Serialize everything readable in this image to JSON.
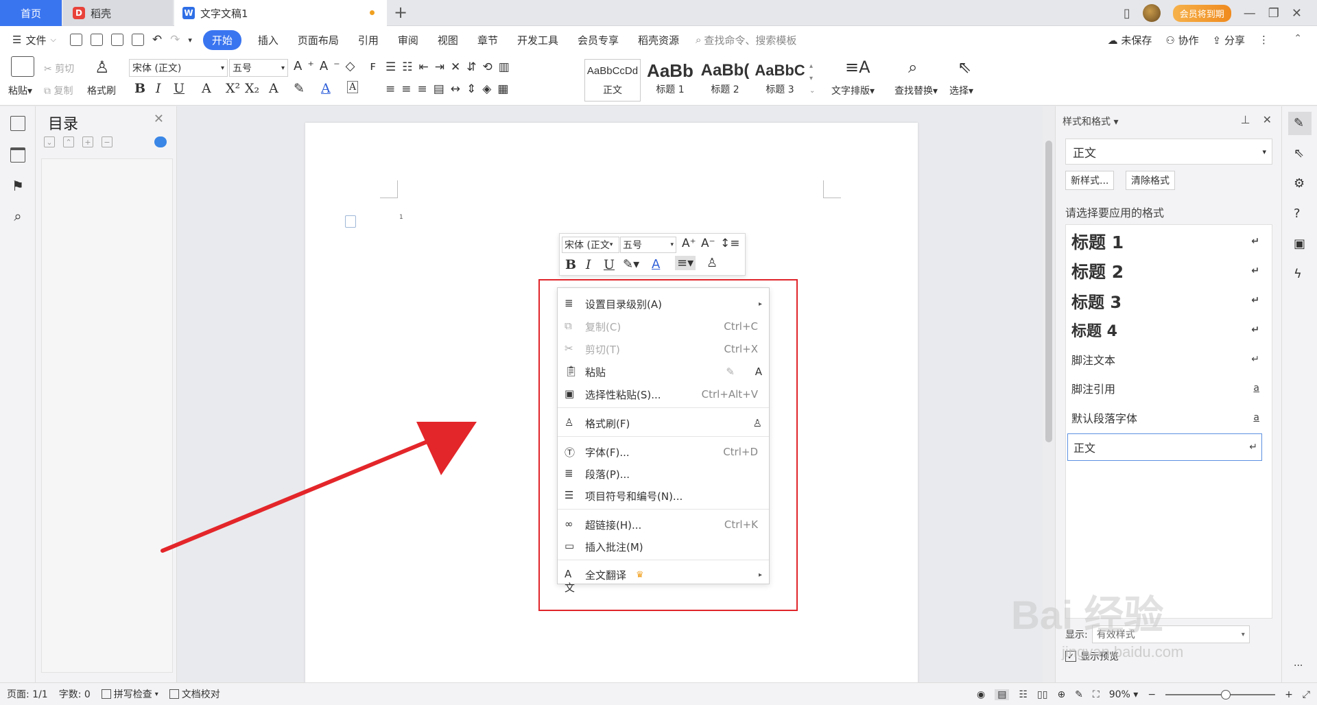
{
  "tabs": {
    "home": "首页",
    "daoke": "稻壳",
    "doc": "文字文稿1",
    "new_tab": "+",
    "vip": "会员将到期"
  },
  "menubar": {
    "file": "文件",
    "start": "开始",
    "items": [
      "插入",
      "页面布局",
      "引用",
      "审阅",
      "视图",
      "章节",
      "开发工具",
      "会员专享",
      "稻壳资源"
    ],
    "search_placeholder": "查找命令、搜索模板",
    "unsaved": "未保存",
    "collab": "协作",
    "share": "分享"
  },
  "ribbon": {
    "paste": "粘贴",
    "cut": "剪切",
    "copy": "复制",
    "format_painter": "格式刷",
    "font_name": "宋体 (正文)",
    "font_size": "五号",
    "styles": [
      {
        "sample": "AaBbCcDd",
        "label": "正文"
      },
      {
        "sample": "AaBb",
        "label": "标题 1"
      },
      {
        "sample": "AaBb(",
        "label": "标题 2"
      },
      {
        "sample": "AaBbC",
        "label": "标题 3"
      }
    ],
    "text_layout": "文字排版",
    "find_replace": "查找替换",
    "select": "选择"
  },
  "nav_pane": {
    "title": "目录"
  },
  "document": {
    "para_mark": "1"
  },
  "mini_toolbar": {
    "font_name": "宋体 (正文",
    "font_size": "五号"
  },
  "context_menu": {
    "items": [
      {
        "label": "设置目录级别(A)",
        "shortcut": "",
        "icon": "toc-level-icon"
      },
      {
        "label": "复制(C)",
        "shortcut": "Ctrl+C",
        "icon": "copy-icon"
      },
      {
        "label": "剪切(T)",
        "shortcut": "Ctrl+X",
        "icon": "cut-icon"
      },
      {
        "label": "粘贴",
        "shortcut": "",
        "icon": "paste-icon"
      },
      {
        "label": "选择性粘贴(S)...",
        "shortcut": "Ctrl+Alt+V",
        "icon": "paste-special-icon"
      },
      {
        "label": "格式刷(F)",
        "shortcut": "",
        "icon": "format-painter-icon"
      },
      {
        "label": "字体(F)...",
        "shortcut": "Ctrl+D",
        "icon": "font-icon"
      },
      {
        "label": "段落(P)...",
        "shortcut": "",
        "icon": "paragraph-icon"
      },
      {
        "label": "项目符号和编号(N)...",
        "shortcut": "",
        "icon": "bullets-icon"
      },
      {
        "label": "超链接(H)...",
        "shortcut": "Ctrl+K",
        "icon": "hyperlink-icon"
      },
      {
        "label": "插入批注(M)",
        "shortcut": "",
        "icon": "comment-icon"
      },
      {
        "label": "全文翻译",
        "shortcut": "",
        "icon": "translate-icon"
      }
    ]
  },
  "right_panel": {
    "title": "样式和格式",
    "current_style": "正文",
    "new_style": "新样式...",
    "clear_format": "清除格式",
    "prompt": "请选择要应用的格式",
    "styles": [
      {
        "label": "标题  1",
        "mark": "↵"
      },
      {
        "label": "标题  2",
        "mark": "↵"
      },
      {
        "label": "标题  3",
        "mark": "↵"
      },
      {
        "label": "标题  4",
        "mark": "↵"
      },
      {
        "label": "脚注文本",
        "mark": "↵"
      },
      {
        "label": "脚注引用",
        "mark": "a"
      },
      {
        "label": "默认段落字体",
        "mark": "a"
      },
      {
        "label": "正文",
        "mark": "↵"
      }
    ],
    "show_label": "显示:",
    "show_value": "有效样式",
    "preview_label": "显示预览"
  },
  "statusbar": {
    "page": "页面: 1/1",
    "words": "字数: 0",
    "spell": "拼写检查",
    "proof": "文档校对",
    "zoom": "90%",
    "zoom_fraction": 0.55
  },
  "watermark": {
    "main": "Bai 经验",
    "sub": "jingyan.baidu.com"
  },
  "colors": {
    "accent": "#3a75f0",
    "highlight_frame": "#e0242a",
    "arrow": "#e3262a"
  }
}
